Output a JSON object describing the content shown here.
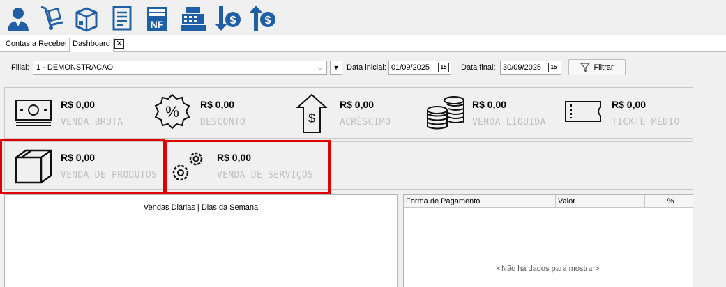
{
  "toolbar": {
    "icons": [
      "client-icon",
      "cart-icon",
      "product-box-icon",
      "report-icon",
      "invoice-nf-icon",
      "cash-register-icon",
      "money-down-icon",
      "money-up-icon"
    ],
    "nf_text": "NF"
  },
  "tabs": [
    {
      "label": "Contas a Receber",
      "active": false
    },
    {
      "label": "Dashboard",
      "active": true
    }
  ],
  "filters": {
    "filial_label": "Filial:",
    "filial_value": "1 - DEMONSTRACAO",
    "data_inicial_label": "Data inicial:",
    "data_inicial_value": "01/09/2025",
    "data_final_label": "Data final:",
    "data_final_value": "30/09/2025",
    "filtrar_label": "Filtrar",
    "calendar_text": "15"
  },
  "cards_row1": [
    {
      "value": "R$ 0,00",
      "label": "VENDA BRUTA",
      "icon": "cash-icon"
    },
    {
      "value": "R$ 0,00",
      "label": "DESCONTO",
      "icon": "percent-badge-icon"
    },
    {
      "value": "R$ 0,00",
      "label": "ACRÉSCIMO",
      "icon": "money-arrow-up-icon"
    },
    {
      "value": "R$ 0,00",
      "label": "VENDA LÍQUIDA",
      "icon": "coins-stack-icon"
    },
    {
      "value": "R$ 0,00",
      "label": "TICKTE MÉDIO",
      "icon": "ticket-icon"
    }
  ],
  "cards_row2": [
    {
      "value": "R$ 0,00",
      "label": "VENDA DE PRODUTOS",
      "icon": "box-icon"
    },
    {
      "value": "R$ 0,00",
      "label": "VENDA DE SERVIÇOS",
      "icon": "gears-icon"
    }
  ],
  "chart": {
    "title": "Vendas Diárias | Dias da Semana"
  },
  "payment_grid": {
    "columns": [
      "Forma de Pagamento",
      "Valor",
      "%"
    ],
    "empty_message": "<Não há dados para mostrar>"
  },
  "colors": {
    "accent_blue": "#1f5fa8",
    "highlight_red": "#e00000",
    "label_gray": "#c0c0c0"
  }
}
